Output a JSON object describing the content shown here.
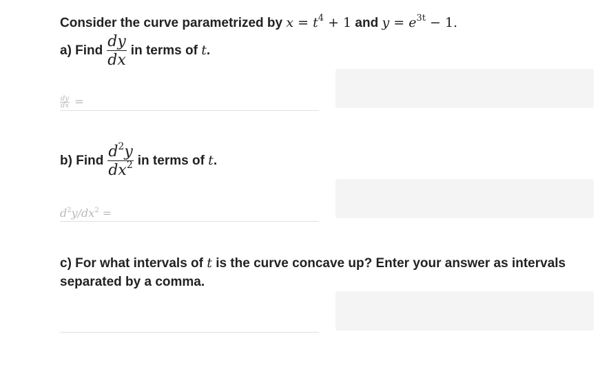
{
  "intro": {
    "lead": "Consider the curve parametrized by",
    "x_eq_1": "x",
    "x_eq_2": " = ",
    "x_eq_3": "t",
    "x_eq_4": "4",
    "x_eq_5": " + 1",
    "joiner": "and",
    "y_eq_1": "y",
    "y_eq_2": " = ",
    "y_eq_3": "e",
    "y_eq_4": "3t",
    "y_eq_5": " − 1."
  },
  "part_a": {
    "label": "a) Find",
    "frac_num": "dy",
    "frac_den": "dx",
    "tail": "in terms of",
    "var": "t",
    "period": ".",
    "answer_prefix_num": "dy",
    "answer_prefix_den": "dx",
    "answer_prefix_eq": "=",
    "answer_value": ""
  },
  "part_b": {
    "label": "b) Find",
    "frac_num_base": "d",
    "frac_num_sup": "2",
    "frac_num_var": "y",
    "frac_den_base": "dx",
    "frac_den_sup": "2",
    "tail": "in terms of",
    "var": "t",
    "period": ".",
    "answer_prefix_1": "d",
    "answer_prefix_2": "2",
    "answer_prefix_3": "y/dx",
    "answer_prefix_4": "2",
    "answer_prefix_eq": "=",
    "answer_value": ""
  },
  "part_c": {
    "line1_lead": "c) For what intervals of",
    "var": "t",
    "line1_tail": "is the curve concave up? Enter your answer as intervals",
    "line2": "separated by a comma.",
    "answer_value": ""
  }
}
